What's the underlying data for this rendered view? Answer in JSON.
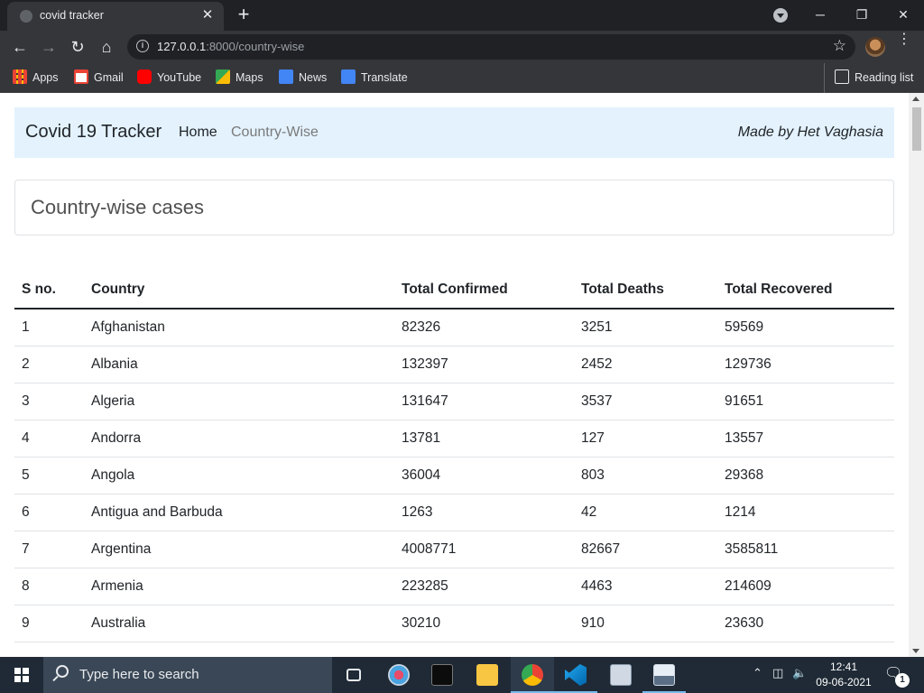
{
  "browser": {
    "tab_title": "covid tracker",
    "tab_close": "✕",
    "new_tab": "+",
    "url_host": "127.0.0.1",
    "url_path": ":8000/country-wise",
    "window_controls": {
      "minimize": "─",
      "restore": "❐",
      "close": "✕"
    },
    "bookmarks": [
      {
        "label": "Apps",
        "icon": "apps-grid-icon",
        "color": "#ea4335"
      },
      {
        "label": "Gmail",
        "icon": "gmail-icon",
        "color": "#ea4335"
      },
      {
        "label": "YouTube",
        "icon": "youtube-icon",
        "color": "#ff0000"
      },
      {
        "label": "Maps",
        "icon": "maps-icon",
        "color": "#34a853"
      },
      {
        "label": "News",
        "icon": "news-icon",
        "color": "#4285f4"
      },
      {
        "label": "Translate",
        "icon": "translate-icon",
        "color": "#4285f4"
      }
    ],
    "reading_list": "Reading list"
  },
  "navbar": {
    "brand": "Covid 19 Tracker",
    "links": [
      "Home",
      "Country-Wise"
    ],
    "active_link": "Country-Wise",
    "made_by": "Made by Het Vaghasia",
    "background": "#e3f2fd"
  },
  "card": {
    "heading": "Country-wise cases"
  },
  "table": {
    "headers": [
      "S no.",
      "Country",
      "Total Confirmed",
      "Total Deaths",
      "Total Recovered"
    ],
    "rows": [
      [
        "1",
        "Afghanistan",
        "82326",
        "3251",
        "59569"
      ],
      [
        "2",
        "Albania",
        "132397",
        "2452",
        "129736"
      ],
      [
        "3",
        "Algeria",
        "131647",
        "3537",
        "91651"
      ],
      [
        "4",
        "Andorra",
        "13781",
        "127",
        "13557"
      ],
      [
        "5",
        "Angola",
        "36004",
        "803",
        "29368"
      ],
      [
        "6",
        "Antigua and Barbuda",
        "1263",
        "42",
        "1214"
      ],
      [
        "7",
        "Argentina",
        "4008771",
        "82667",
        "3585811"
      ],
      [
        "8",
        "Armenia",
        "223285",
        "4463",
        "214609"
      ],
      [
        "9",
        "Australia",
        "30210",
        "910",
        "23630"
      ]
    ]
  },
  "taskbar": {
    "search_placeholder": "Type here to search",
    "time": "12:41",
    "date": "09-06-2021",
    "notification_count": "1"
  }
}
